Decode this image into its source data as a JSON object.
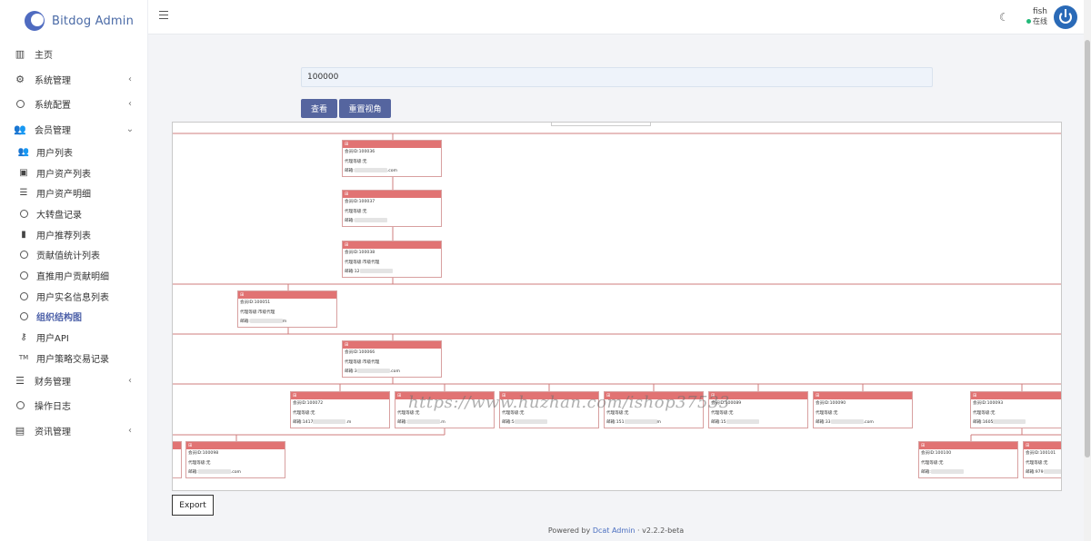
{
  "brand": {
    "name": "Bitdog Admin"
  },
  "sidebar": {
    "items": [
      {
        "label": "主页",
        "icon": "bar-chart-icon",
        "glyph": "▥",
        "level": "top",
        "chevron": ""
      },
      {
        "label": "系统管理",
        "icon": "gear-icon",
        "glyph": "⚙",
        "level": "top",
        "chevron": "‹"
      },
      {
        "label": "系统配置",
        "icon": "circle-icon",
        "glyph": "",
        "level": "top",
        "chevron": "‹"
      },
      {
        "label": "会员管理",
        "icon": "users-icon",
        "glyph": "👥",
        "level": "top",
        "chevron": "⌄"
      },
      {
        "label": "用户列表",
        "icon": "users-icon",
        "glyph": "👥",
        "level": "sub",
        "chevron": ""
      },
      {
        "label": "用户资产列表",
        "icon": "money-icon",
        "glyph": "▣",
        "level": "sub",
        "chevron": ""
      },
      {
        "label": "用户资产明细",
        "icon": "list-icon",
        "glyph": "☰",
        "level": "sub",
        "chevron": ""
      },
      {
        "label": "大转盘记录",
        "icon": "circle-icon",
        "glyph": "",
        "level": "sub",
        "chevron": ""
      },
      {
        "label": "用户推荐列表",
        "icon": "id-badge-icon",
        "glyph": "▮",
        "level": "sub",
        "chevron": ""
      },
      {
        "label": "贡献值统计列表",
        "icon": "circle-icon",
        "glyph": "",
        "level": "sub",
        "chevron": ""
      },
      {
        "label": "直推用户贡献明细",
        "icon": "circle-icon",
        "glyph": "",
        "level": "sub",
        "chevron": ""
      },
      {
        "label": "用户实名信息列表",
        "icon": "circle-icon",
        "glyph": "",
        "level": "sub",
        "chevron": ""
      },
      {
        "label": "组织结构图",
        "icon": "circle-icon",
        "glyph": "",
        "level": "sub",
        "chevron": "",
        "active": true
      },
      {
        "label": "用户API",
        "icon": "key-icon",
        "glyph": "⚷",
        "level": "sub",
        "chevron": ""
      },
      {
        "label": "用户策略交易记录",
        "icon": "trademark-icon",
        "glyph": "TM",
        "level": "sub",
        "chevron": ""
      },
      {
        "label": "财务管理",
        "icon": "list-icon",
        "glyph": "☰",
        "level": "top",
        "chevron": "‹"
      },
      {
        "label": "操作日志",
        "icon": "circle-icon",
        "glyph": "",
        "level": "top",
        "chevron": ""
      },
      {
        "label": "资讯管理",
        "icon": "newspaper-icon",
        "glyph": "▤",
        "level": "top",
        "chevron": "‹"
      }
    ]
  },
  "header": {
    "user_name": "fish",
    "user_status": "在线"
  },
  "search": {
    "value": "100000"
  },
  "buttons": {
    "view": "查看",
    "reset": "重置视角",
    "export": "Export"
  },
  "tree": {
    "nodes": [
      {
        "id": "会员ID:100036",
        "level": "代理等级:无",
        "email": "邮箱:",
        "email_tail": ".com"
      },
      {
        "id": "会员ID:100037",
        "level": "代理等级:无",
        "email": "邮箱:",
        "email_tail": ""
      },
      {
        "id": "会员ID:100038",
        "level": "代理等级:市级代理",
        "email": "邮箱:12",
        "email_tail": ""
      },
      {
        "id": "会员ID:100051",
        "level": "代理等级:市级代理",
        "email": "邮箱:",
        "email_tail": "m"
      },
      {
        "id": "会员ID:100066",
        "level": "代理等级:市级代理",
        "email": "邮箱:3",
        "email_tail": ".com"
      },
      {
        "id": "会员ID:100072",
        "level": "代理等级:无",
        "email": "邮箱:1417",
        "email_tail": ".m"
      },
      {
        "id": "",
        "level": "代理等级:无",
        "email": "邮箱:",
        "email_tail": ".m"
      },
      {
        "id": "",
        "level": "代理等级:无",
        "email": "邮箱:5",
        "email_tail": ""
      },
      {
        "id": "",
        "level": "代理等级:无",
        "email": "邮箱:151",
        "email_tail": "m"
      },
      {
        "id": "会员ID:100089",
        "level": "代理等级:无",
        "email": "邮箱:15",
        "email_tail": ""
      },
      {
        "id": "会员ID:100090",
        "level": "代理等级:无",
        "email": "邮箱:33",
        "email_tail": ".com"
      },
      {
        "id": "会员ID:100093",
        "level": "代理等级:无",
        "email": "邮箱:1605",
        "email_tail": ""
      },
      {
        "id": "会员ID:100098",
        "level": "代理等级:无",
        "email": "邮箱:",
        "email_tail": ".com"
      },
      {
        "id": "会员ID:100100",
        "level": "代理等级:无",
        "email": "邮箱:",
        "email_tail": ""
      },
      {
        "id": "会员ID:100101",
        "level": "代理等级:无",
        "email": "邮箱:979",
        "email_tail": ""
      },
      {
        "id": "",
        "level": "代理等级:无",
        "email": "邮箱:",
        "email_tail": ""
      }
    ]
  },
  "watermark": "https://www.huzhan.com/ishop37533",
  "footer": {
    "prefix": "Powered by",
    "link": "Dcat Admin",
    "sep": "·",
    "version": "v2.2.2-beta"
  }
}
